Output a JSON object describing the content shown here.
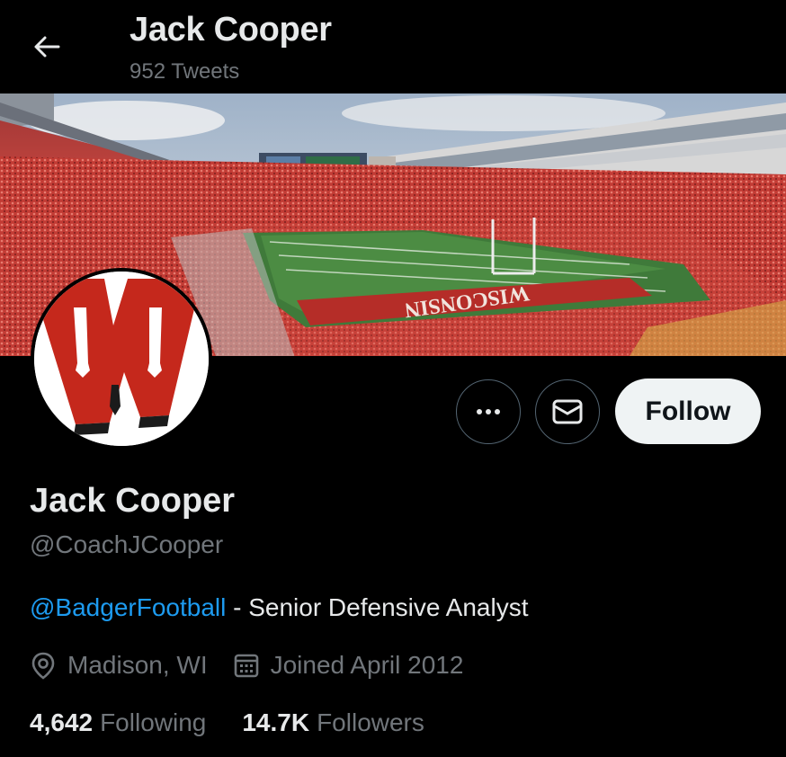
{
  "header": {
    "title": "Jack Cooper",
    "tweet_count": "952 Tweets",
    "back_icon": "arrow-left-icon"
  },
  "banner": {
    "description": "stadium-photo",
    "end_zone_text": "WISCONSIN"
  },
  "avatar": {
    "icon": "wisconsin-w-logo",
    "logo_letter": "W",
    "colors": {
      "red": "#c5281c",
      "white": "#ffffff"
    }
  },
  "actions": {
    "more_icon": "more-icon",
    "message_icon": "envelope-icon",
    "follow_label": "Follow"
  },
  "profile": {
    "name": "Jack Cooper",
    "handle": "@CoachJCooper",
    "bio_mention": "@BadgerFootball",
    "bio_text": " - Senior Defensive Analyst",
    "location": "Madison, WI",
    "location_icon": "location-pin-icon",
    "joined": "Joined April 2012",
    "joined_icon": "calendar-icon"
  },
  "stats": {
    "following_count": "4,642",
    "following_label": "Following",
    "followers_count": "14.7K",
    "followers_label": "Followers"
  },
  "colors": {
    "background": "#000000",
    "text_primary": "#e7e9ea",
    "text_secondary": "#71767b",
    "link": "#1d9bf0",
    "button_border": "#536471",
    "follow_bg": "#eff3f4"
  }
}
